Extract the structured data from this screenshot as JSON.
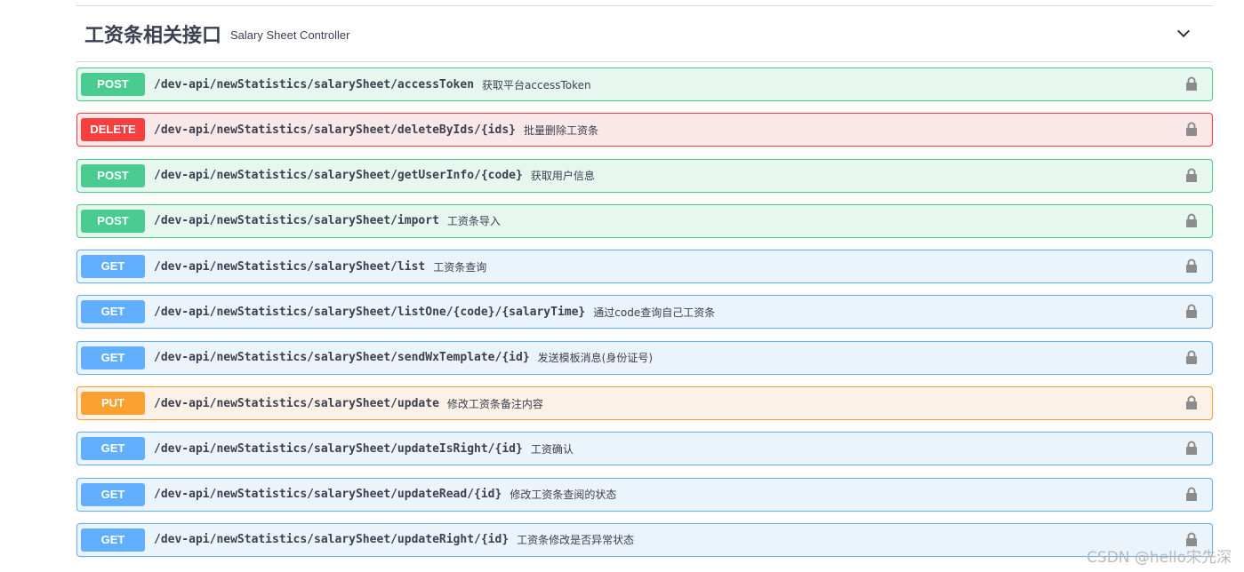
{
  "section": {
    "title": "工资条相关接口",
    "description": "Salary Sheet Controller"
  },
  "operations": [
    {
      "method": "POST",
      "path": "/dev-api/newStatistics/salarySheet/accessToken",
      "summary": "获取平台accessToken"
    },
    {
      "method": "DELETE",
      "path": "/dev-api/newStatistics/salarySheet/deleteByIds/{ids}",
      "summary": "批量删除工资条"
    },
    {
      "method": "POST",
      "path": "/dev-api/newStatistics/salarySheet/getUserInfo/{code}",
      "summary": "获取用户信息"
    },
    {
      "method": "POST",
      "path": "/dev-api/newStatistics/salarySheet/import",
      "summary": "工资条导入"
    },
    {
      "method": "GET",
      "path": "/dev-api/newStatistics/salarySheet/list",
      "summary": "工资条查询"
    },
    {
      "method": "GET",
      "path": "/dev-api/newStatistics/salarySheet/listOne/{code}/{salaryTime}",
      "summary": "通过code查询自己工资条"
    },
    {
      "method": "GET",
      "path": "/dev-api/newStatistics/salarySheet/sendWxTemplate/{id}",
      "summary": "发送模板消息(身份证号)"
    },
    {
      "method": "PUT",
      "path": "/dev-api/newStatistics/salarySheet/update",
      "summary": "修改工资条备注内容"
    },
    {
      "method": "GET",
      "path": "/dev-api/newStatistics/salarySheet/updateIsRight/{id}",
      "summary": "工资确认"
    },
    {
      "method": "GET",
      "path": "/dev-api/newStatistics/salarySheet/updateRead/{id}",
      "summary": "修改工资条查阅的状态"
    },
    {
      "method": "GET",
      "path": "/dev-api/newStatistics/salarySheet/updateRight/{id}",
      "summary": "工资条修改是否异常状态"
    }
  ],
  "icons": {
    "collapse": "chevron-down-icon",
    "lock": "lock-icon"
  },
  "colors": {
    "post": "#49cc90",
    "delete": "#f93e3e",
    "get": "#61affe",
    "put": "#fca130",
    "text": "#3b4151"
  },
  "watermark": "CSDN @hello宋先深"
}
